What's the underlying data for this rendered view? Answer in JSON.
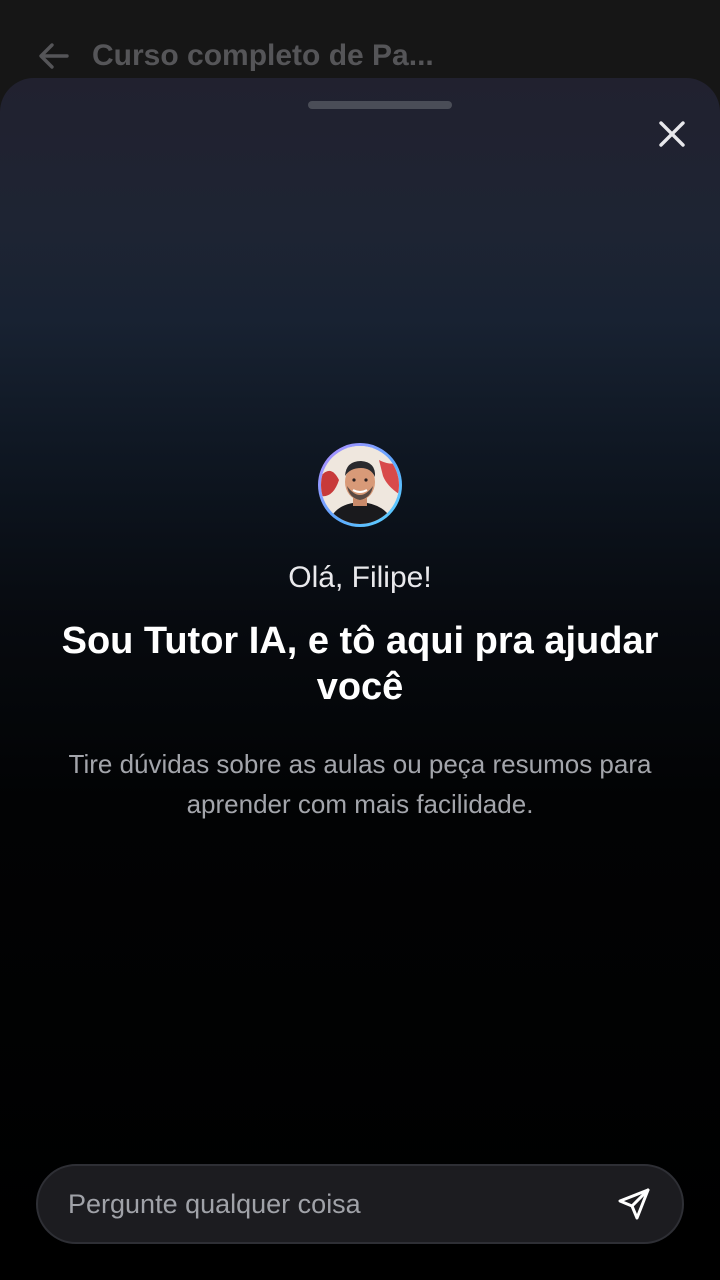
{
  "header": {
    "title": "Curso completo de Pa...",
    "back_icon": "arrow-left-icon"
  },
  "sheet": {
    "close_icon": "close-icon",
    "avatar": "tutor-avatar",
    "greeting": "Olá, Filipe!",
    "headline": "Sou Tutor IA, e tô aqui pra ajudar você",
    "subtitle": "Tire dúvidas sobre as aulas ou peça resumos para aprender com mais facilidade."
  },
  "input": {
    "value": "",
    "placeholder": "Pergunte qualquer coisa",
    "send_icon": "send-icon"
  },
  "colors": {
    "sheet_top": "#21212f",
    "sheet_bottom": "#000000",
    "avatar_ring_start": "#b98cff",
    "avatar_ring_end": "#5ad8ff",
    "headline": "#ffffff",
    "subtitle": "#a3a5ab"
  }
}
